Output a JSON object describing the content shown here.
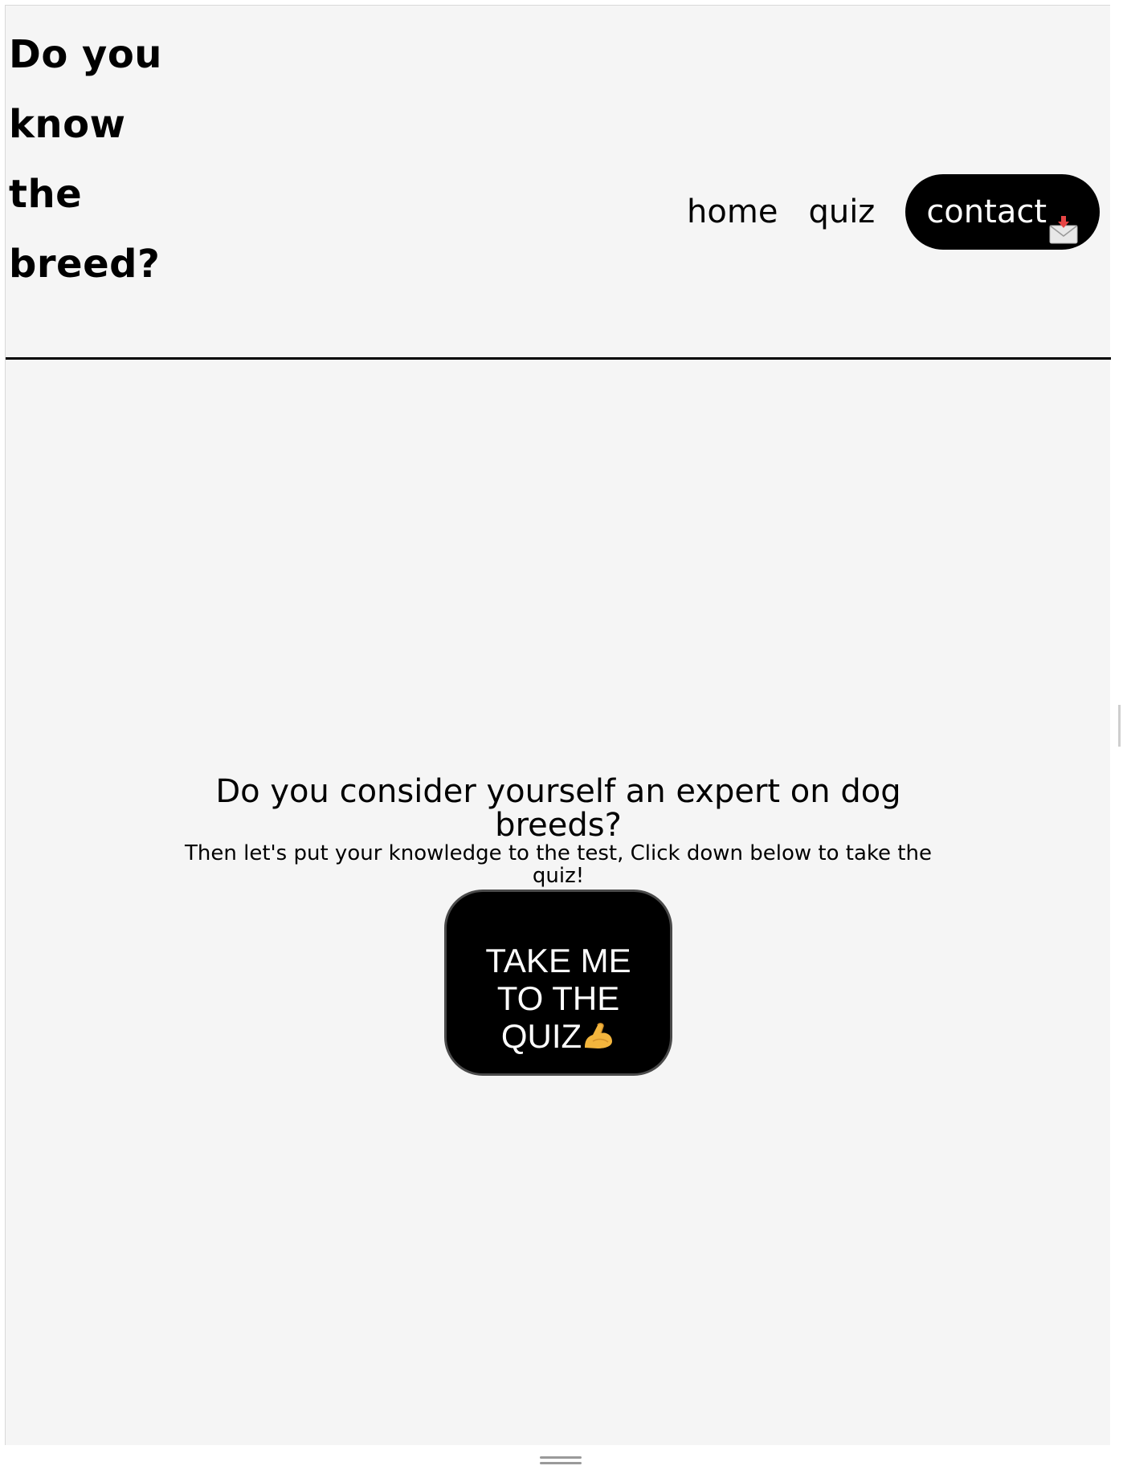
{
  "header": {
    "brand_title": "Do you know the breed?",
    "nav": {
      "home": "home",
      "quiz": "quiz",
      "contact": "contact",
      "contact_icon": "envelope-with-arrow-icon"
    }
  },
  "hero": {
    "title": "Do you consider yourself an expert on dog breeds?",
    "subtitle": "Then let's put your knowledge to the test, Click down below to take the quiz!",
    "cta_label": "TAKE ME TO THE QUIZ",
    "cta_icon": "flexed-biceps-icon"
  },
  "colors": {
    "background": "#f5f5f5",
    "accent": "#000000",
    "button_text": "#ffffff"
  }
}
